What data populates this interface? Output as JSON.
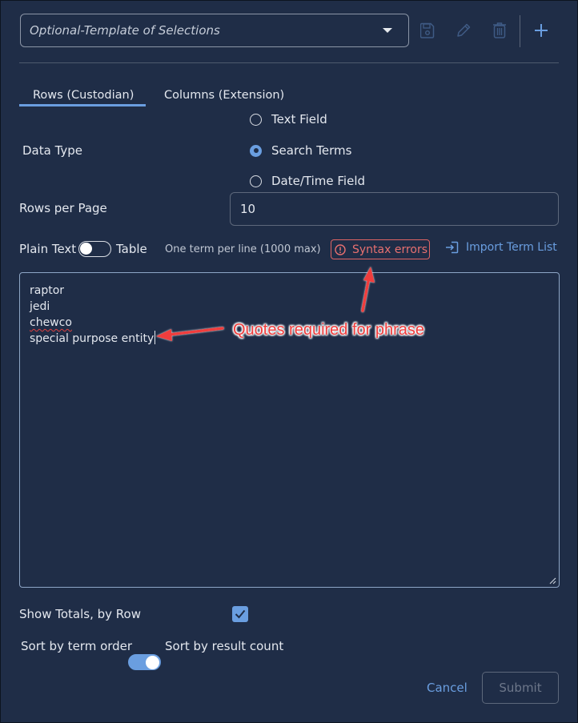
{
  "template_select": {
    "placeholder": "Optional-Template of Selections",
    "icon": "chevron-down-icon"
  },
  "toolbar": {
    "icons": [
      "save-icon",
      "pencil-icon",
      "trash-icon",
      "plus-icon"
    ]
  },
  "tabs": [
    {
      "label": "Rows (Custodian)",
      "active": true
    },
    {
      "label": "Columns (Extension)",
      "active": false
    }
  ],
  "data_type": {
    "label": "Data Type",
    "options": [
      {
        "label": "Text Field",
        "checked": false
      },
      {
        "label": "Search Terms",
        "checked": true
      },
      {
        "label": "Date/Time Field",
        "checked": false
      }
    ]
  },
  "rows_per_page": {
    "label": "Rows per Page",
    "value": "10"
  },
  "format_toggle": {
    "left_label": "Plain Text",
    "right_label": "Table",
    "state": "Plain Text"
  },
  "terms_hint": "One term per line (1000 max)",
  "syntax_errors": {
    "label": "Syntax errors",
    "icon": "alert-circle-icon"
  },
  "import_term_list": {
    "label": "Import Term List",
    "icon": "import-icon"
  },
  "terms": [
    {
      "text": "raptor",
      "misspelled": false
    },
    {
      "text": "jedi",
      "misspelled": false
    },
    {
      "text": "chewco",
      "misspelled": true
    },
    {
      "text": "special purpose entity",
      "misspelled": false
    }
  ],
  "annotation": {
    "text": "Quotes required for phrase",
    "color": "#f03c3c"
  },
  "show_totals": {
    "label": "Show Totals, by Row",
    "checked": true
  },
  "sort_toggle": {
    "left_label": "Sort by term order",
    "right_label": "Sort by result count",
    "state": "Sort by result count"
  },
  "footer": {
    "cancel_label": "Cancel",
    "submit_label": "Submit",
    "submit_disabled": true
  },
  "colors": {
    "background": "#1f2d47",
    "accent": "#6a9ee0",
    "error": "#e06565"
  }
}
